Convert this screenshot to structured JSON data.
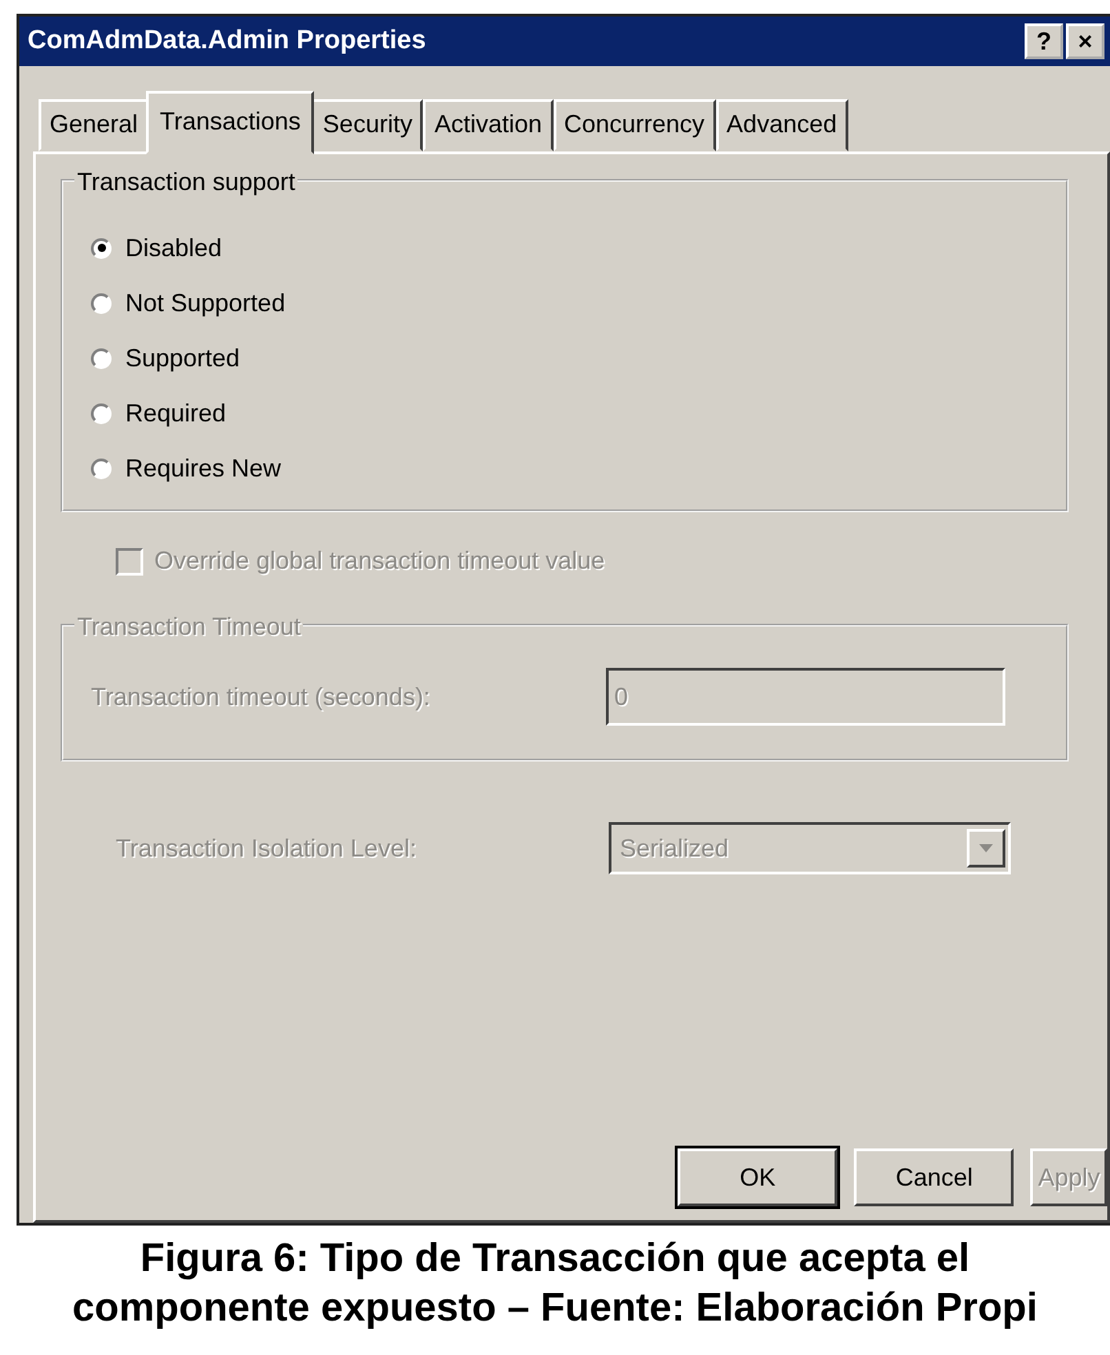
{
  "window": {
    "title": "ComAdmData.Admin Properties",
    "title_buttons": [
      "?",
      "×"
    ]
  },
  "tabs": [
    {
      "label": "General",
      "selected": false
    },
    {
      "label": "Transactions",
      "selected": true
    },
    {
      "label": "Security",
      "selected": false
    },
    {
      "label": "Activation",
      "selected": false
    },
    {
      "label": "Concurrency",
      "selected": false
    },
    {
      "label": "Advanced",
      "selected": false
    }
  ],
  "transaction_support": {
    "title": "Transaction support",
    "options": [
      {
        "label": "Disabled",
        "selected": true
      },
      {
        "label": "Not Supported",
        "selected": false
      },
      {
        "label": "Supported",
        "selected": false
      },
      {
        "label": "Required",
        "selected": false
      },
      {
        "label": "Requires New",
        "selected": false
      }
    ]
  },
  "override_timeout": {
    "label": "Override global transaction timeout value",
    "checked": false,
    "disabled": true
  },
  "transaction_timeout": {
    "title": "Transaction Timeout",
    "label": "Transaction timeout (seconds):",
    "value": "0",
    "disabled": true
  },
  "isolation_level": {
    "label": "Transaction Isolation Level:",
    "value": "Serialized",
    "disabled": true
  },
  "buttons": [
    {
      "label": "OK",
      "disabled": false,
      "default": true
    },
    {
      "label": "Cancel",
      "disabled": false,
      "default": false
    },
    {
      "label": "Apply",
      "disabled": true,
      "default": false
    }
  ],
  "caption": {
    "lines": [
      "Figura 6: Tipo de Transacción que acepta el",
      "componente expuesto – Fuente: Elaboración Propi"
    ]
  }
}
